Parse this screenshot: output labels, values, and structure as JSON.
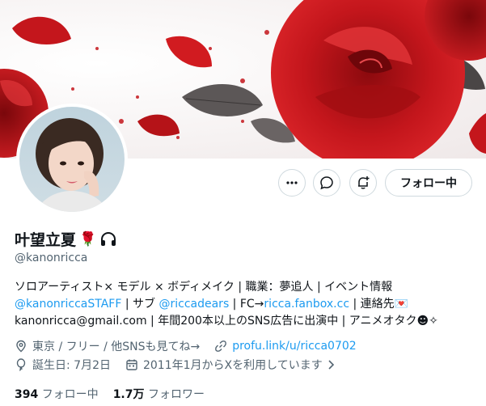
{
  "profile": {
    "display_name": "叶望立夏",
    "name_emoji": "🌹",
    "handle": "@kanonricca",
    "bio_line1": "ソロアーティスト× モデル × ボディメイク | 職業：夢追人 | イベント情報",
    "bio_mention1": "@kanonriccaSTAFF",
    "bio_sep1": " | サブ ",
    "bio_mention2": "@riccadears",
    "bio_sep2": " | FC→",
    "bio_link": "ricca.fanbox.cc",
    "bio_sep3": " | 連絡先💌",
    "bio_line3": "kanonricca@gmail.com | 年間200本以上のSNS広告に出演中 | アニメオタク☻✧",
    "location": "東京 / フリー / 他SNSも見てね→",
    "website": "profu.link/u/ricca0702",
    "birthday": "誕生日: 7月2日",
    "joined": "2011年1月からXを利用しています",
    "following_count": "394",
    "following_label": "フォロー中",
    "followers_count": "1.7万",
    "followers_label": "フォロワー"
  },
  "actions": {
    "follow_label": "フォロー中"
  },
  "colors": {
    "accent": "#1d9bf0",
    "rose": "#c4161c",
    "text_secondary": "#536471"
  }
}
